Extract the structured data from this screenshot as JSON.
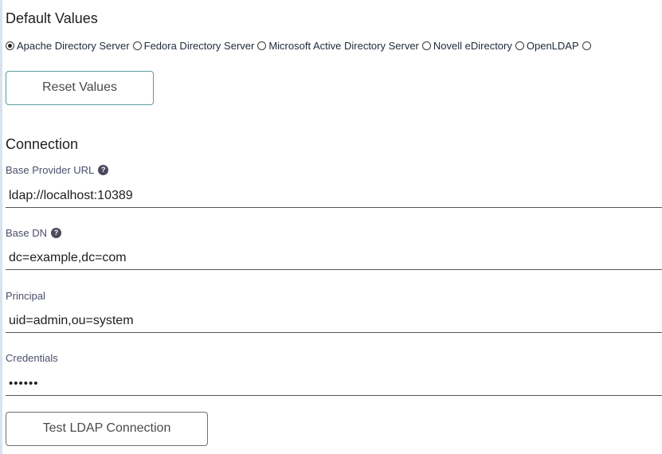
{
  "defaults": {
    "title": "Default Values",
    "options": [
      {
        "label": "Apache Directory Server",
        "selected": true
      },
      {
        "label": "Fedora Directory Server",
        "selected": false
      },
      {
        "label": "Microsoft Active Directory Server",
        "selected": false
      },
      {
        "label": "Novell eDirectory",
        "selected": false
      },
      {
        "label": "OpenLDAP",
        "selected": false
      }
    ],
    "reset_label": "Reset Values"
  },
  "connection": {
    "title": "Connection",
    "base_url": {
      "label": "Base Provider URL",
      "value": "ldap://localhost:10389",
      "help_icon": "question-circle-icon"
    },
    "base_dn": {
      "label": "Base DN",
      "value": "dc=example,dc=com",
      "help_icon": "question-circle-icon"
    },
    "principal": {
      "label": "Principal",
      "value": "uid=admin,ou=system"
    },
    "credentials": {
      "label": "Credentials",
      "value": "••••••"
    },
    "test_label": "Test LDAP Connection"
  },
  "colors": {
    "reset_border": "#5b9aa3",
    "test_border": "#6f6f6f",
    "field_underline": "#555555"
  }
}
